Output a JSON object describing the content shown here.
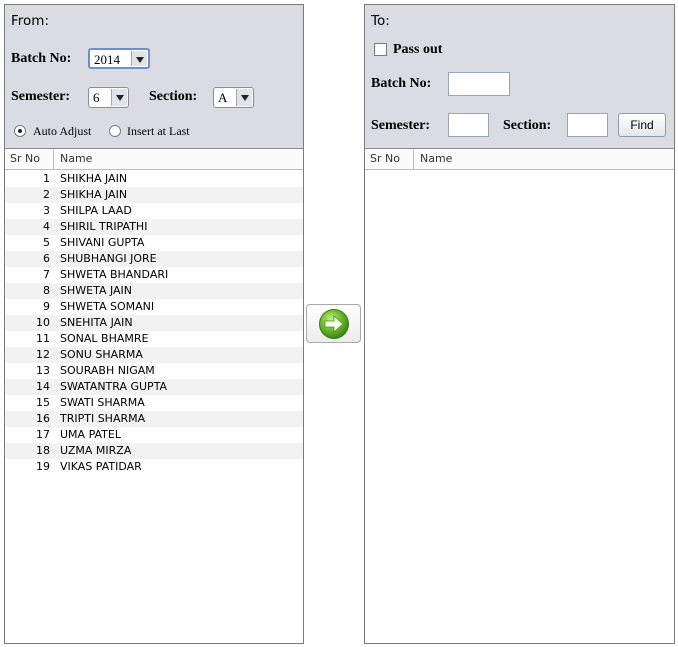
{
  "from": {
    "title": "From:",
    "batch_label": "Batch No:",
    "batch_value": "2014",
    "semester_label": "Semester:",
    "semester_value": "6",
    "section_label": "Section:",
    "section_value": "A",
    "radio_auto": "Auto Adjust",
    "radio_auto_selected": true,
    "radio_last": "Insert at Last",
    "table": {
      "columns": [
        "Sr No",
        "Name"
      ],
      "rows": [
        {
          "sr": "1",
          "name": "SHIKHA JAIN"
        },
        {
          "sr": "2",
          "name": "SHIKHA JAIN"
        },
        {
          "sr": "3",
          "name": "SHILPA LAAD"
        },
        {
          "sr": "4",
          "name": "SHIRIL TRIPATHI"
        },
        {
          "sr": "5",
          "name": "SHIVANI GUPTA"
        },
        {
          "sr": "6",
          "name": "SHUBHANGI JORE"
        },
        {
          "sr": "7",
          "name": "SHWETA BHANDARI"
        },
        {
          "sr": "8",
          "name": "SHWETA JAIN"
        },
        {
          "sr": "9",
          "name": "SHWETA SOMANI"
        },
        {
          "sr": "10",
          "name": "SNEHITA JAIN"
        },
        {
          "sr": "11",
          "name": "SONAL BHAMRE"
        },
        {
          "sr": "12",
          "name": "SONU SHARMA"
        },
        {
          "sr": "13",
          "name": "SOURABH NIGAM"
        },
        {
          "sr": "14",
          "name": "SWATANTRA GUPTA"
        },
        {
          "sr": "15",
          "name": "SWATI SHARMA"
        },
        {
          "sr": "16",
          "name": "TRIPTI SHARMA"
        },
        {
          "sr": "17",
          "name": "UMA PATEL"
        },
        {
          "sr": "18",
          "name": "UZMA MIRZA"
        },
        {
          "sr": "19",
          "name": "VIKAS PATIDAR"
        }
      ]
    }
  },
  "to": {
    "title": "To:",
    "passout_label": "Pass out",
    "batch_label": "Batch No:",
    "batch_value": "",
    "semester_label": "Semester:",
    "semester_value": "",
    "section_label": "Section:",
    "section_value": "",
    "find_label": "Find",
    "table": {
      "columns": [
        "Sr No",
        "Name"
      ],
      "rows": []
    }
  },
  "transfer_icon": "green-arrow-right-icon",
  "colors": {
    "panel_header_bg": "#dadbe3",
    "arrow_green": "#5fae2a"
  }
}
